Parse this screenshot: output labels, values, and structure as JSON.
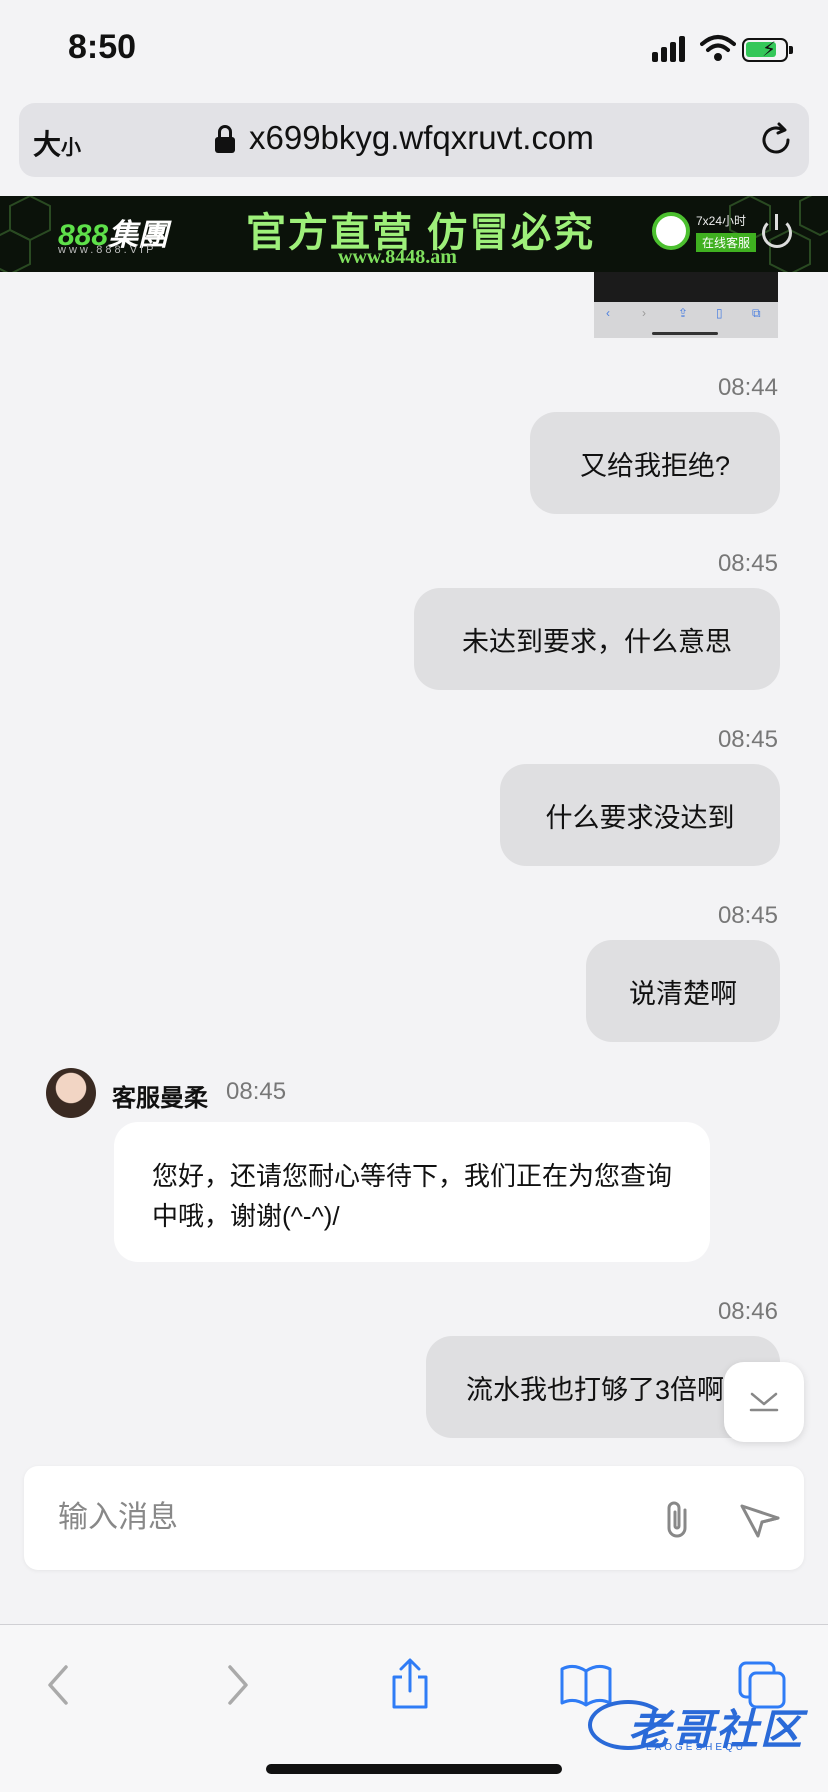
{
  "status": {
    "time": "8:50"
  },
  "browser": {
    "text_size_big": "大",
    "text_size_small": "小",
    "url": "x699bkyg.wfqxruvt.com"
  },
  "banner": {
    "brand_num": "888",
    "brand_name": "集團",
    "domain": "www.888.VIP",
    "slogan": "官方直营 仿冒必究",
    "site": "www.8448.am",
    "service_line1": "7x24小时",
    "service_line2": "在线客服"
  },
  "messages": [
    {
      "time": "08:44",
      "text": "又给我拒绝?"
    },
    {
      "time": "08:45",
      "text": "未达到要求，什么意思"
    },
    {
      "time": "08:45",
      "text": "什么要求没达到"
    },
    {
      "time": "08:45",
      "text": "说清楚啊"
    }
  ],
  "agent_message": {
    "name": "客服曼柔",
    "time": "08:45",
    "text": "您好，还请您耐心等待下，我们正在为您查询中哦，谢谢(^-^)/"
  },
  "last_message": {
    "time": "08:46",
    "text": "流水我也打够了3倍啊"
  },
  "composer": {
    "placeholder": "输入消息",
    "value": ""
  },
  "watermark": {
    "text": "老哥社区",
    "sub": "LAOGESHEQU"
  },
  "colors": {
    "bubble_out": "#dfdfe1",
    "bubble_in": "#ffffff",
    "background": "#f3f3f5",
    "link_blue": "#2f7cf6"
  }
}
